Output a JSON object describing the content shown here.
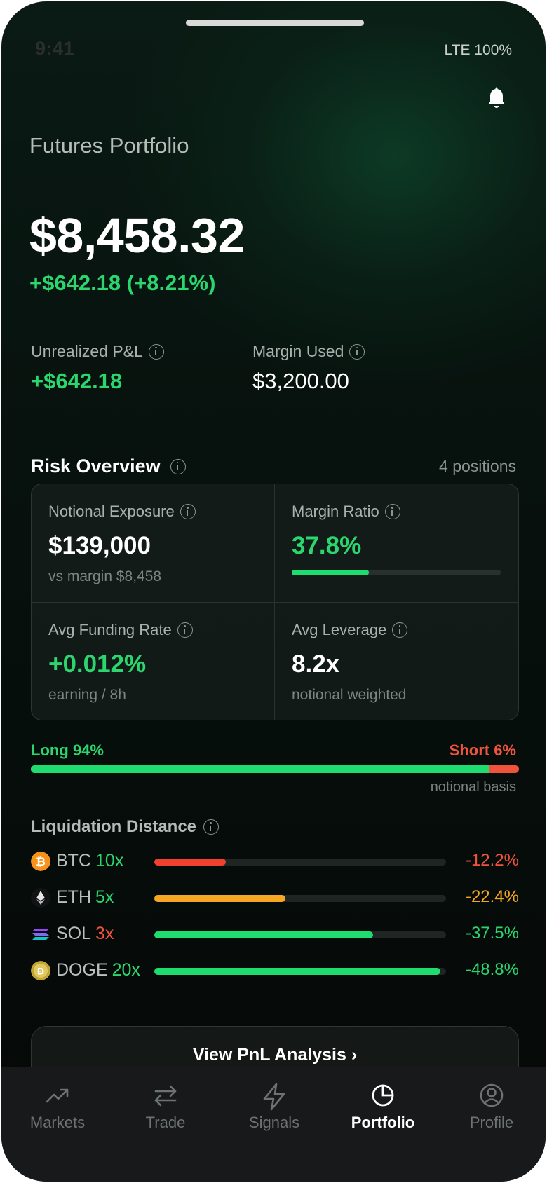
{
  "status": {
    "time": "9:41",
    "network": "LTE 100%"
  },
  "header": {
    "bell_icon": "bell-icon"
  },
  "portfolio": {
    "title": "Futures Portfolio",
    "total_value": "$8,458.32",
    "change": "+$642.18 (+8.21%)"
  },
  "stats": {
    "unrealized_label": "Unrealized P&L",
    "unrealized_value": "+$642.18",
    "margin_label": "Margin Used",
    "margin_value": "$3,200.00"
  },
  "risk": {
    "title": "Risk Overview",
    "positions": "4 positions",
    "cells": [
      {
        "label": "Notional Exposure",
        "value": "$139,000",
        "sub": "vs margin $8,458"
      },
      {
        "label": "Margin Ratio",
        "value": "37.8%",
        "progress": 0.378
      },
      {
        "label": "Avg Funding Rate",
        "value": "+0.012%",
        "sub": "earning / 8h"
      },
      {
        "label": "Avg Leverage",
        "value": "8.2x",
        "sub": "notional weighted"
      }
    ]
  },
  "long_short": {
    "long_label": "Long 94%",
    "short_label": "Short 6%",
    "long_fraction": 0.94,
    "note": "notional basis"
  },
  "liquidation": {
    "title": "Liquidation Distance",
    "rows": [
      {
        "symbol": "BTC",
        "leverage": "10x",
        "leverage_color": "#2bd66f",
        "distance": "-12.2%",
        "fraction": 0.245,
        "color": "#f0412f",
        "pct_color": "#f0533c",
        "icon": "bitcoin-icon"
      },
      {
        "symbol": "ETH",
        "leverage": "5x",
        "leverage_color": "#2bd66f",
        "distance": "-22.4%",
        "fraction": 0.45,
        "color": "#f5a623",
        "pct_color": "#f5a623",
        "icon": "ethereum-icon"
      },
      {
        "symbol": "SOL",
        "leverage": "3x",
        "leverage_color": "#f0533c",
        "distance": "-37.5%",
        "fraction": 0.75,
        "color": "#1fdc70",
        "pct_color": "#2bd66f",
        "icon": "solana-icon"
      },
      {
        "symbol": "DOGE",
        "leverage": "20x",
        "leverage_color": "#2bd66f",
        "distance": "-48.8%",
        "fraction": 0.98,
        "color": "#1fdc70",
        "pct_color": "#2bd66f",
        "icon": "dogecoin-icon"
      }
    ]
  },
  "cta": {
    "label": "View PnL Analysis ›"
  },
  "tabs": [
    {
      "label": "Markets",
      "icon": "trend-up-icon"
    },
    {
      "label": "Trade",
      "icon": "swap-icon"
    },
    {
      "label": "Signals",
      "icon": "lightning-icon"
    },
    {
      "label": "Portfolio",
      "icon": "pie-chart-icon",
      "active": true
    },
    {
      "label": "Profile",
      "icon": "user-circle-icon"
    }
  ],
  "colors": {
    "positive": "#2bd66f",
    "negative": "#f0533c",
    "warning": "#f5a623"
  }
}
